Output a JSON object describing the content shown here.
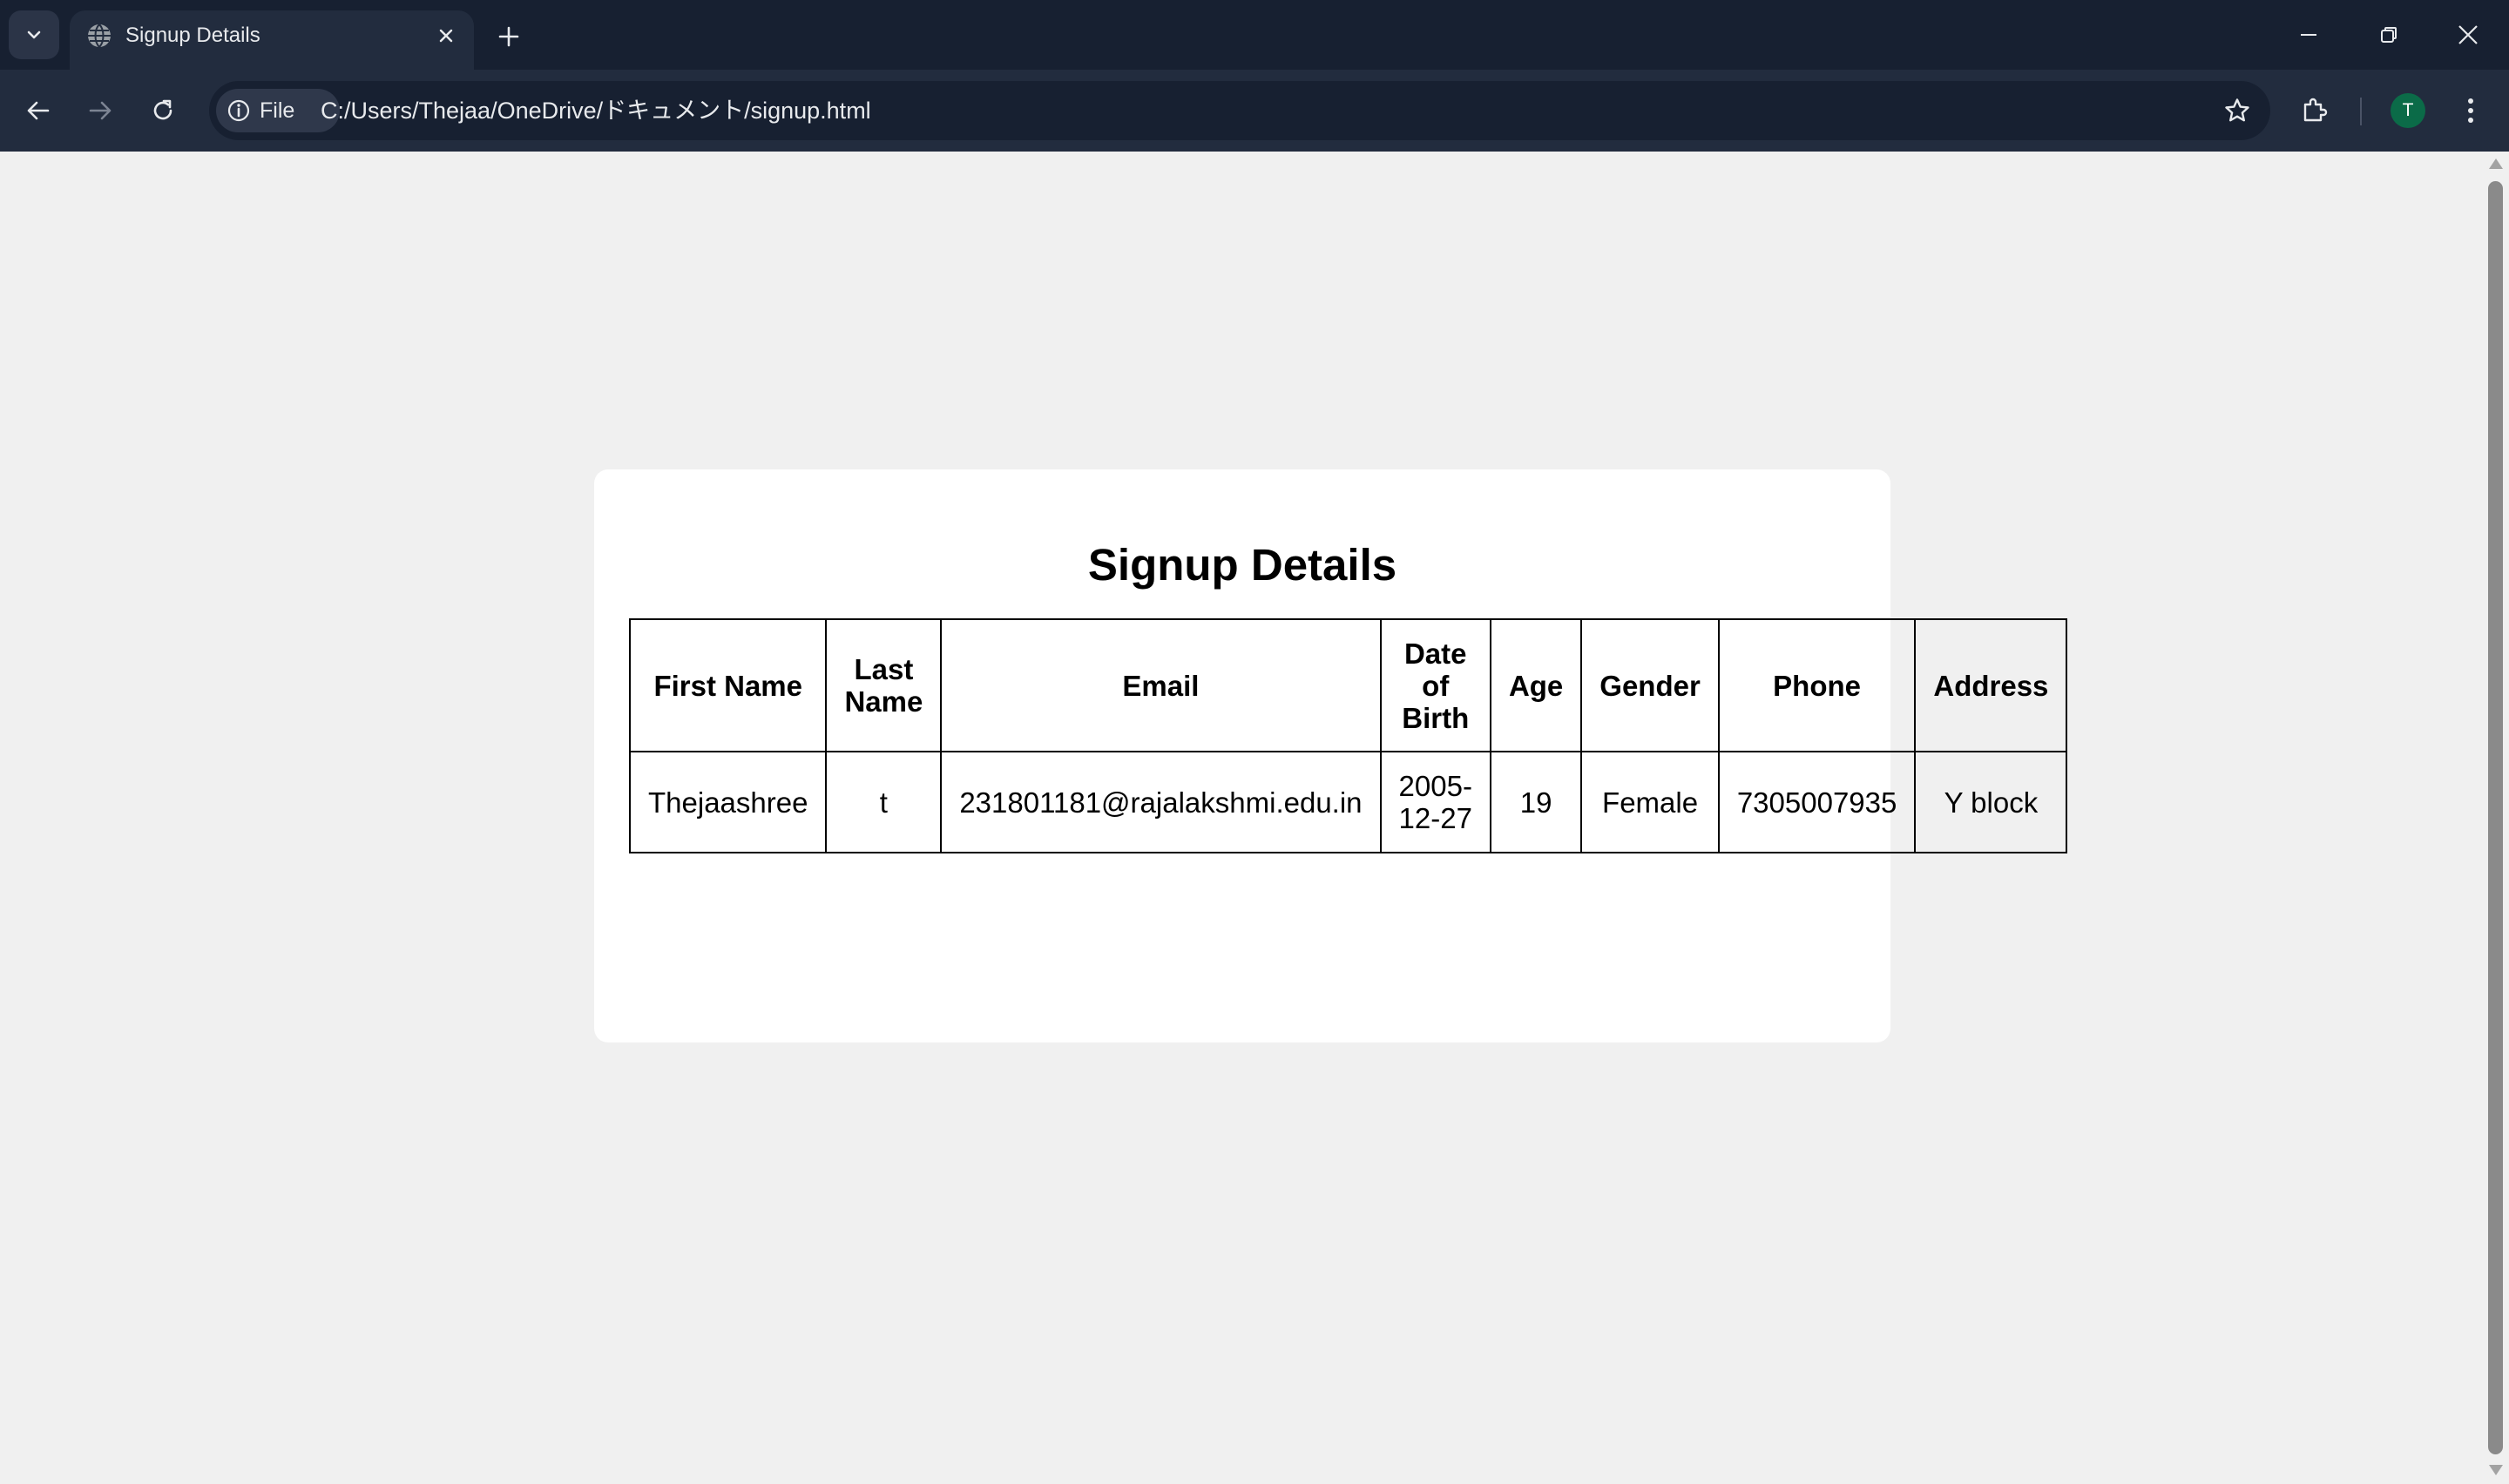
{
  "browser": {
    "tab": {
      "title": "Signup Details"
    },
    "address_bar": {
      "site_info_label": "File",
      "url": "C:/Users/Thejaa/OneDrive/ドキュメント/signup.html"
    },
    "profile_initial": "T"
  },
  "page": {
    "title": "Signup Details",
    "table": {
      "headers": {
        "first_name": "First Name",
        "last_name": "Last Name",
        "email": "Email",
        "dob": "Date of Birth",
        "age": "Age",
        "gender": "Gender",
        "phone": "Phone",
        "address": "Address"
      },
      "row": {
        "first_name": "Thejaashree",
        "last_name": "t",
        "email": "231801181@rajalakshmi.edu.in",
        "dob": "2005-12-27",
        "age": "19",
        "gender": "Female",
        "phone": "7305007935",
        "address": "Y block"
      }
    }
  },
  "colors": {
    "chrome_dark": "#172031",
    "toolbar": "#222c3e",
    "page_background": "#f0f0f0",
    "card_background": "#ffffff",
    "avatar": "#0b6b48"
  },
  "icons": [
    "tab-search-icon",
    "globe-icon",
    "close-icon",
    "plus-icon",
    "minimize-icon",
    "restore-icon",
    "back-icon",
    "forward-icon",
    "reload-icon",
    "info-icon",
    "star-icon",
    "extensions-icon",
    "more-icon"
  ]
}
